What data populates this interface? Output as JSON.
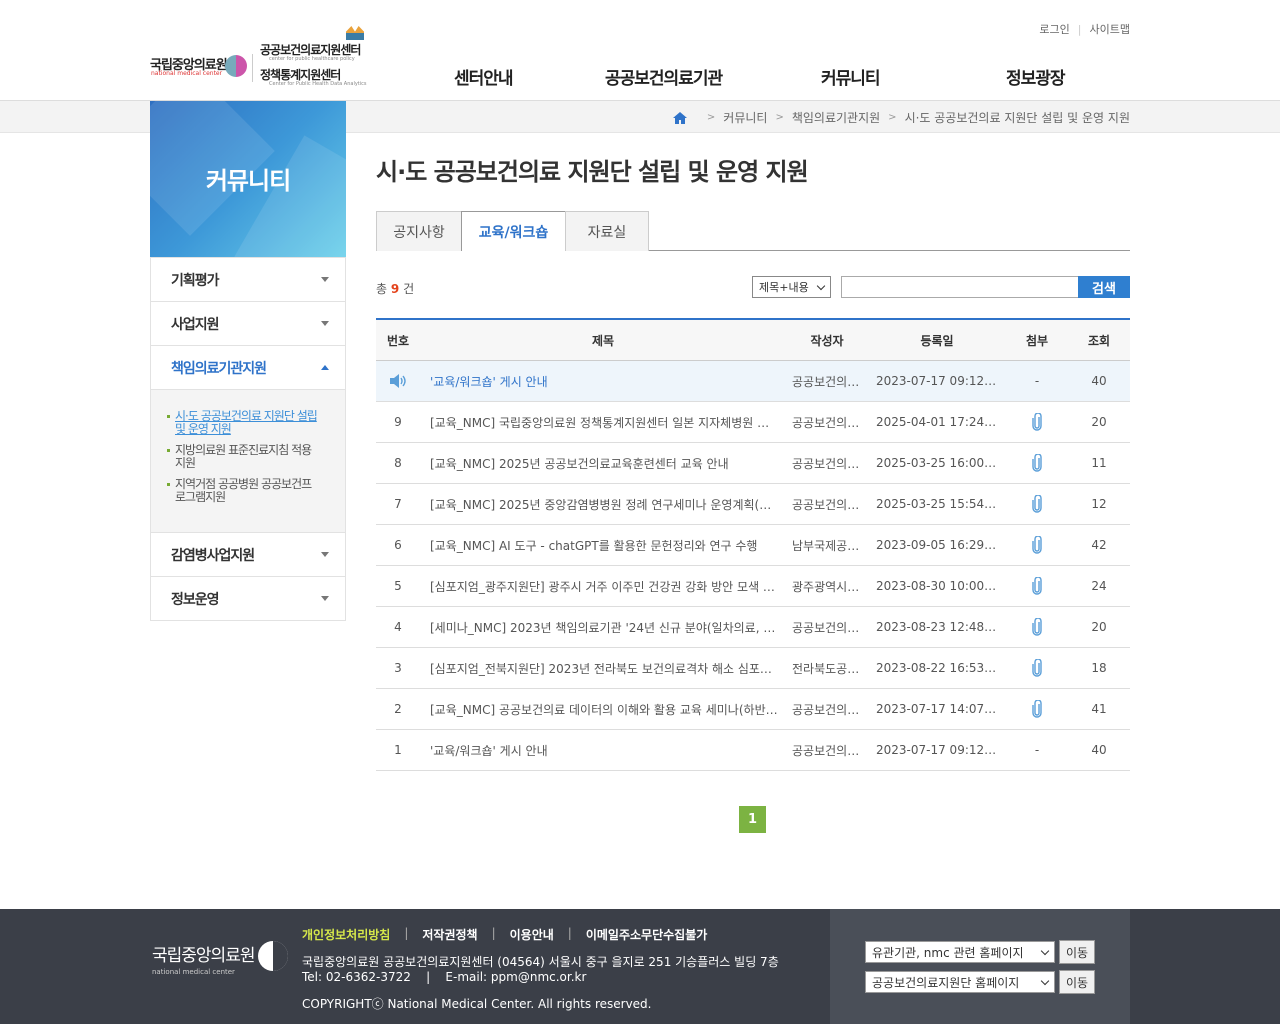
{
  "header": {
    "logo_nmc": "국립중앙의료원",
    "logo_nmc_sub": "national medical center",
    "logo_center1": "공공보건의료지원센터",
    "logo_center1_sub": "center for public healthcare policy",
    "logo_center2": "정책통계지원센터",
    "logo_center2_sub": "Center for Public Health Data Analytics",
    "util_login": "로그인",
    "util_sitemap": "사이트맵",
    "gnb": [
      "센터안내",
      "공공보건의료기관",
      "커뮤니티",
      "정보광장"
    ]
  },
  "breadcrumb": [
    "커뮤니티",
    "책임의료기관지원",
    "시·도 공공보건의료 지원단 설립 및 운영 지원"
  ],
  "sidebar": {
    "banner_title": "커뮤니티",
    "items": [
      {
        "label": "기획평가"
      },
      {
        "label": "사업지원"
      },
      {
        "label": "책임의료기관지원"
      },
      {
        "label": "감염병사업지원"
      },
      {
        "label": "정보운영"
      }
    ],
    "sub_items": [
      {
        "label": "시·도 공공보건의료 지원단 설립 및 운영 지원"
      },
      {
        "label": "지방의료원 표준진료지침 적용 지원"
      },
      {
        "label": "지역거점 공공병원 공공보건프로그램지원"
      }
    ]
  },
  "page": {
    "title": "시·도 공공보건의료 지원단 설립 및 운영 지원",
    "tabs": [
      "공지사항",
      "교육/워크숍",
      "자료실"
    ],
    "count_prefix": "총",
    "count_value": "9",
    "count_suffix": "건",
    "search_select": "제목+내용",
    "search_value": "",
    "search_button": "검색"
  },
  "table": {
    "headers": [
      "번호",
      "제목",
      "작성자",
      "등록일",
      "첨부",
      "조회"
    ],
    "notice": {
      "title": "'교육/워크숍' 게시 안내",
      "writer": "공공보건의료지원센터",
      "date": "2023-07-17 09:12:4…",
      "file": "-",
      "views": "40"
    },
    "rows": [
      {
        "no": "9",
        "title": "[교육_NMC] 국립중앙의료원 정책통계지원센터 일본 지자체병원 …",
        "writer": "공공보건의료지원센터",
        "date": "2025-04-01 17:24:0…",
        "file": "clip",
        "views": "20"
      },
      {
        "no": "8",
        "title": "[교육_NMC] 2025년 공공보건의료교육훈련센터 교육 안내",
        "writer": "공공보건의료지원센터",
        "date": "2025-03-25 16:00:3…",
        "file": "clip",
        "views": "11"
      },
      {
        "no": "7",
        "title": "[교육_NMC] 2025년 중앙감염병병원 정례 연구세미나 운영계획(…",
        "writer": "공공보건의료지원센터",
        "date": "2025-03-25 15:54:1…",
        "file": "clip",
        "views": "12"
      },
      {
        "no": "6",
        "title": "[교육_NMC] AI 도구 - chatGPT를 활용한 문헌정리와 연구 수행",
        "writer": "남부국제공공보건의료지원단",
        "date": "2023-09-05 16:29:0…",
        "file": "clip",
        "views": "42"
      },
      {
        "no": "5",
        "title": "[심포지엄_광주지원단] 광주시 거주 이주민 건강권 강화 방안 모색 …",
        "writer": "광주광역시공공보건의료지원단",
        "date": "2023-08-30 10:00:0…",
        "file": "clip",
        "views": "24"
      },
      {
        "no": "4",
        "title": "[세미나_NMC] 2023년 책임의료기관 '24년 신규 분야(일차의료, …",
        "writer": "공공보건의료지원센터",
        "date": "2023-08-23 12:48:3…",
        "file": "clip",
        "views": "20"
      },
      {
        "no": "3",
        "title": "[심포지엄_전북지원단] 2023년 전라북도 보건의료격차 해소 심포…",
        "writer": "전라북도공공보건의료지원단",
        "date": "2023-08-22 16:53:0…",
        "file": "clip",
        "views": "18"
      },
      {
        "no": "2",
        "title": "[교육_NMC] 공공보건의료 데이터의 이해와 활용 교육 세미나(하반…",
        "writer": "공공보건의료지원센터",
        "date": "2023-07-17 14:07:1…",
        "file": "clip",
        "views": "41"
      },
      {
        "no": "1",
        "title": "'교육/워크숍' 게시 안내",
        "writer": "공공보건의료지원센터",
        "date": "2023-07-17 09:12:4…",
        "file": "-",
        "views": "40"
      }
    ]
  },
  "pager": {
    "current": "1"
  },
  "footer": {
    "logo": "국립중앙의료원",
    "logo_sub": "national medical center",
    "links": [
      "개인정보처리방침",
      "저작권정책",
      "이용안내",
      "이메일주소무단수집불가"
    ],
    "address": "국립중앙의료원 공공보건의료지원센터 (04564) 서울시 중구 을지로 251 기승플러스 빌딩 7층",
    "contact": "Tel: 02-6362-3722    |    E-mail: ppm@nmc.or.kr",
    "copyright": "COPYRIGHTⓒ National Medical Center. All rights reserved.",
    "select1": "유관기관, nmc 관련 홈페이지",
    "select2": "공공보건의료지원단 홈페이지",
    "go_button": "이동"
  },
  "colors": {
    "accent": "#2f73c9",
    "count": "#e4431c",
    "pager": "#7cb342",
    "footer_bg": "#3b3f48",
    "footer_link_on": "#d6e84a"
  }
}
